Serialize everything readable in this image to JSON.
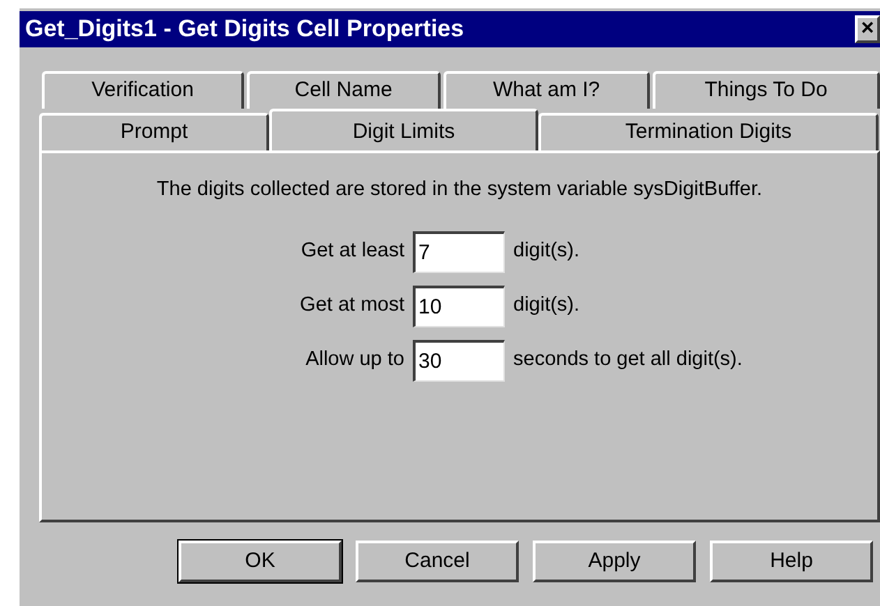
{
  "window": {
    "title": "Get_Digits1 - Get Digits Cell Properties",
    "close": "×"
  },
  "tab_rows": [
    [
      {
        "label": "Verification",
        "selected": false
      },
      {
        "label": "Cell Name",
        "selected": false
      },
      {
        "label": "What am I?",
        "selected": false
      },
      {
        "label": "Things To Do",
        "selected": false
      }
    ],
    [
      {
        "label": "Prompt",
        "selected": false
      },
      {
        "label": "Digit Limits",
        "selected": true
      },
      {
        "label": "Termination Digits",
        "selected": false
      }
    ]
  ],
  "description": "The digits collected are stored in the system variable sysDigitBuffer.",
  "fields": [
    {
      "label": "Get at least",
      "value": "7",
      "suffix": "digit(s)."
    },
    {
      "label": "Get at most",
      "value": "10",
      "suffix": "digit(s)."
    },
    {
      "label": "Allow up to",
      "value": "30",
      "suffix": "seconds to get all digit(s)."
    }
  ],
  "buttons": [
    {
      "label": "OK",
      "default": true
    },
    {
      "label": "Cancel",
      "default": false
    },
    {
      "label": "Apply",
      "default": false
    },
    {
      "label": "Help",
      "default": false
    }
  ]
}
